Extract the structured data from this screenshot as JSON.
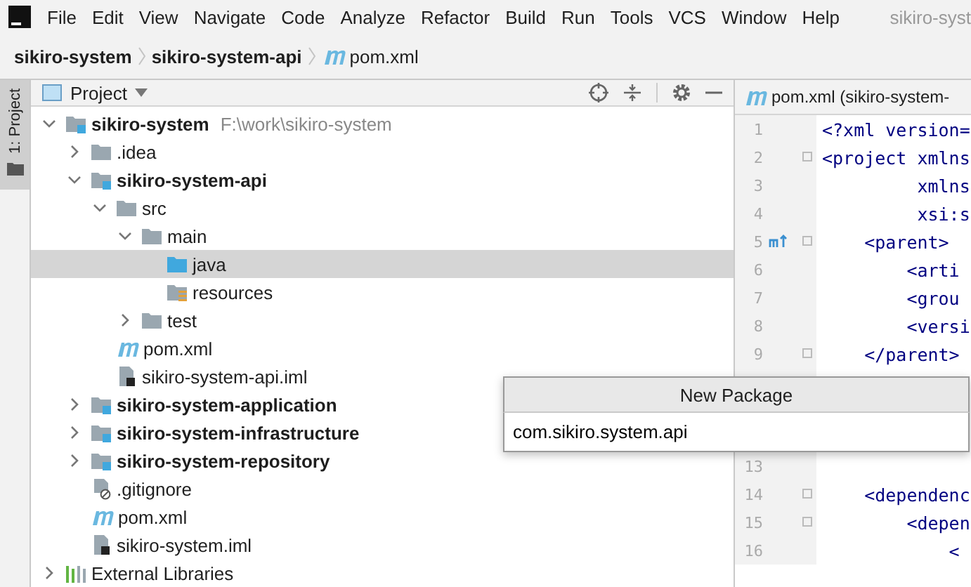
{
  "menu_bar": {
    "items": [
      "File",
      "Edit",
      "View",
      "Navigate",
      "Code",
      "Analyze",
      "Refactor",
      "Build",
      "Run",
      "Tools",
      "VCS",
      "Window",
      "Help"
    ],
    "title": "sikiro-syst"
  },
  "breadcrumbs": [
    {
      "label": "sikiro-system",
      "kind": "module"
    },
    {
      "label": "sikiro-system-api",
      "kind": "module"
    },
    {
      "label": "pom.xml",
      "kind": "maven"
    }
  ],
  "side_strip": {
    "label": "1: Project"
  },
  "project_panel": {
    "title": "Project",
    "tree": [
      {
        "label": "sikiro-system",
        "hint": "F:\\work\\sikiro-system",
        "kind": "module",
        "bold": true,
        "expanded": true,
        "selected": false,
        "children": [
          {
            "label": ".idea",
            "kind": "folder",
            "bold": false,
            "expanded": false,
            "selected": false
          },
          {
            "label": "sikiro-system-api",
            "kind": "module",
            "bold": true,
            "expanded": true,
            "selected": false,
            "children": [
              {
                "label": "src",
                "kind": "folder",
                "bold": false,
                "expanded": true,
                "selected": false,
                "children": [
                  {
                    "label": "main",
                    "kind": "folder",
                    "bold": false,
                    "expanded": true,
                    "selected": false,
                    "children": [
                      {
                        "label": "java",
                        "kind": "source",
                        "bold": false,
                        "selected": true
                      },
                      {
                        "label": "resources",
                        "kind": "resources",
                        "bold": false,
                        "selected": false
                      }
                    ]
                  },
                  {
                    "label": "test",
                    "kind": "folder",
                    "bold": false,
                    "expanded": false,
                    "selected": false
                  }
                ]
              },
              {
                "label": "pom.xml",
                "kind": "maven",
                "bold": false,
                "selected": false
              },
              {
                "label": "sikiro-system-api.iml",
                "kind": "iml",
                "bold": false,
                "selected": false
              }
            ]
          },
          {
            "label": "sikiro-system-application",
            "kind": "module",
            "bold": true,
            "expanded": false,
            "selected": false
          },
          {
            "label": "sikiro-system-infrastructure",
            "kind": "module",
            "bold": true,
            "expanded": false,
            "selected": false
          },
          {
            "label": "sikiro-system-repository",
            "kind": "module",
            "bold": true,
            "expanded": false,
            "selected": false
          },
          {
            "label": ".gitignore",
            "kind": "ignore",
            "bold": false,
            "selected": false
          },
          {
            "label": "pom.xml",
            "kind": "maven",
            "bold": false,
            "selected": false
          },
          {
            "label": "sikiro-system.iml",
            "kind": "iml",
            "bold": false,
            "selected": false
          }
        ]
      },
      {
        "label": "External Libraries",
        "kind": "library",
        "bold": false,
        "expanded": false,
        "selected": false
      }
    ]
  },
  "editor": {
    "tab": "pom.xml (sikiro-system-",
    "lines": [
      {
        "number": "1",
        "text": "<?xml version=",
        "fold": false,
        "marker": false
      },
      {
        "number": "2",
        "text": "<project xmlns",
        "fold": true,
        "marker": false
      },
      {
        "number": "3",
        "text": "         xmlns",
        "fold": false,
        "marker": false
      },
      {
        "number": "4",
        "text": "         xsi:s",
        "fold": false,
        "marker": false
      },
      {
        "number": "5",
        "text": "    <parent>",
        "fold": true,
        "marker": true
      },
      {
        "number": "6",
        "text": "        <arti",
        "fold": false,
        "marker": false
      },
      {
        "number": "7",
        "text": "        <grou",
        "fold": false,
        "marker": false
      },
      {
        "number": "8",
        "text": "        <versi",
        "fold": false,
        "marker": false
      },
      {
        "number": "9",
        "text": "    </parent>",
        "fold": true,
        "marker": false
      },
      {
        "number": "13",
        "fold": false,
        "marker": false
      },
      {
        "number": "14",
        "text": "    <dependenc",
        "fold": true,
        "marker": false
      },
      {
        "number": "15",
        "text": "        <depen",
        "fold": true,
        "marker": false
      },
      {
        "number": "16",
        "text": "            <",
        "fold": false,
        "marker": false
      }
    ]
  },
  "popup": {
    "title": "New Package",
    "value": "com.sikiro.system.api"
  }
}
